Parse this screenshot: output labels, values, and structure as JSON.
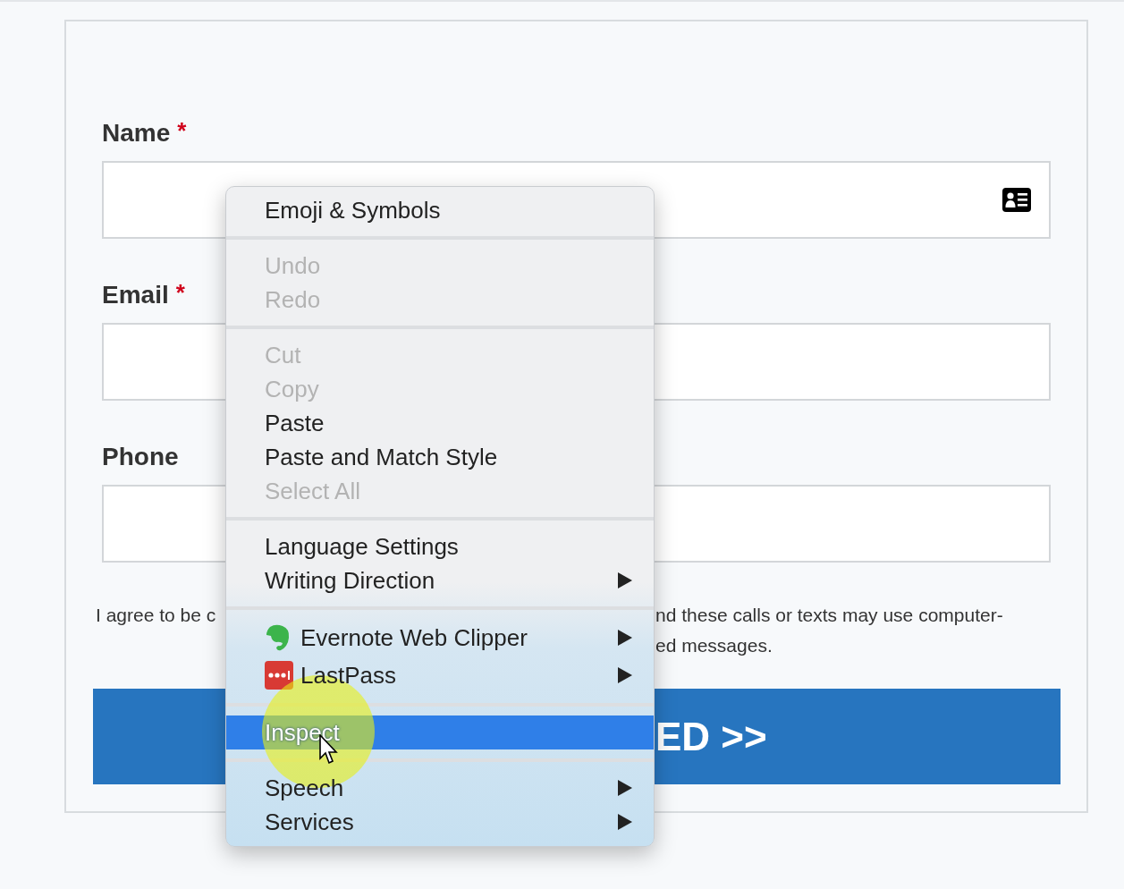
{
  "form": {
    "fields": [
      {
        "label": "Name",
        "required_mark": "*",
        "contact_icon": true
      },
      {
        "label": "Email",
        "required_mark": "*",
        "contact_icon": false
      },
      {
        "label": "Phone",
        "contact_icon": false
      }
    ],
    "consent": {
      "line_1_left": "I agree to be c",
      "line_1_right": "nd these calls or texts may use computer-",
      "line_2_right": "ed messages."
    },
    "submit_button": {
      "label": "ED >>"
    }
  },
  "context_menu": {
    "groups": [
      [
        {
          "label": "Emoji & Symbols",
          "kind": "plain",
          "disabled": false,
          "submenu": false,
          "selected": false
        }
      ],
      [
        {
          "label": "Undo",
          "kind": "plain",
          "disabled": true,
          "submenu": false,
          "selected": false
        },
        {
          "label": "Redo",
          "kind": "plain",
          "disabled": true,
          "submenu": false,
          "selected": false
        }
      ],
      [
        {
          "label": "Cut",
          "kind": "plain",
          "disabled": true,
          "submenu": false,
          "selected": false
        },
        {
          "label": "Copy",
          "kind": "plain",
          "disabled": true,
          "submenu": false,
          "selected": false
        },
        {
          "label": "Paste",
          "kind": "plain",
          "disabled": false,
          "submenu": false,
          "selected": false
        },
        {
          "label": "Paste and Match Style",
          "kind": "plain",
          "disabled": false,
          "submenu": false,
          "selected": false
        },
        {
          "label": "Select All",
          "kind": "plain",
          "disabled": true,
          "submenu": false,
          "selected": false
        }
      ],
      [
        {
          "label": "Language Settings",
          "kind": "plain",
          "disabled": false,
          "submenu": false,
          "selected": false
        },
        {
          "label": "Writing Direction",
          "kind": "plain",
          "disabled": false,
          "submenu": true,
          "selected": false
        }
      ],
      [
        {
          "label": "Evernote Web Clipper",
          "kind": "extension",
          "disabled": false,
          "submenu": true,
          "selected": false
        },
        {
          "label": "LastPass",
          "kind": "extension",
          "disabled": false,
          "submenu": true,
          "selected": false
        }
      ],
      [
        {
          "label": "Inspect",
          "kind": "plain",
          "disabled": false,
          "submenu": false,
          "selected": true
        }
      ],
      [
        {
          "label": "Speech",
          "kind": "plain",
          "disabled": false,
          "submenu": true,
          "selected": false
        },
        {
          "label": "Services",
          "kind": "plain",
          "disabled": false,
          "submenu": true,
          "selected": false
        }
      ]
    ]
  }
}
